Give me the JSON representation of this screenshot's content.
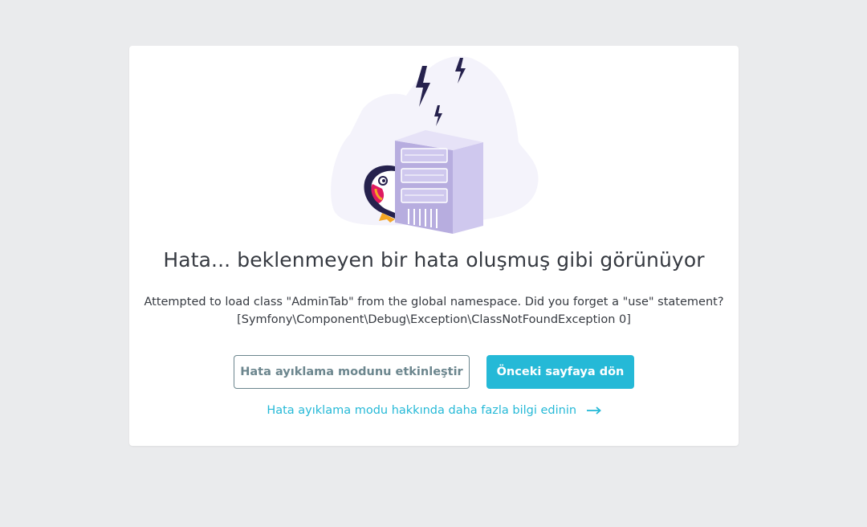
{
  "error": {
    "title": "Hata... beklenmeyen bir hata oluşmuş gibi görünüyor",
    "message_line1": "Attempted to load class \"AdminTab\" from the global namespace. Did you forget a \"use\" statement?",
    "message_line2": "[Symfony\\Component\\Debug\\Exception\\ClassNotFoundException 0]"
  },
  "actions": {
    "enable_debug_label": "Hata ayıklama modunu etkinleştir",
    "go_back_label": "Önceki sayfaya dön",
    "learn_more_label": "Hata ayıklama modu hakkında daha fazla bilgi edinin"
  },
  "illustration": {
    "name": "puffin-server-error-illustration"
  },
  "colors": {
    "background": "#eaebed",
    "accent": "#25b9d7",
    "outline": "#6c868e",
    "text": "#363a41",
    "server": "#c5bfe8",
    "bolt": "#25214d"
  }
}
